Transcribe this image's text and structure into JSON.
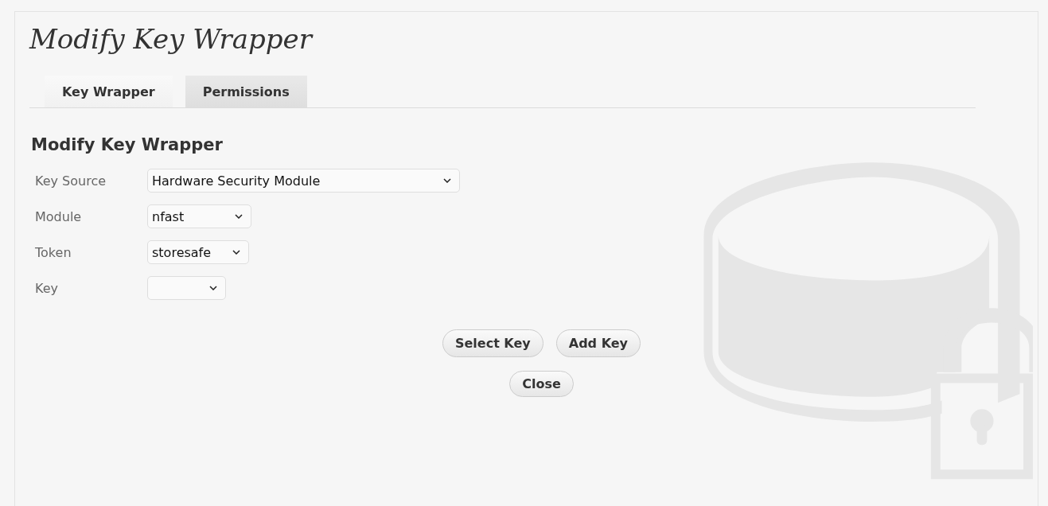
{
  "page_title": "Modify Key Wrapper",
  "tabs": [
    {
      "label": "Key Wrapper",
      "selected": true
    },
    {
      "label": "Permissions",
      "selected": false
    }
  ],
  "section_heading": "Modify Key Wrapper",
  "fields": [
    {
      "label": "Key Source",
      "value": "Hardware Security Module"
    },
    {
      "label": "Module",
      "value": "nfast"
    },
    {
      "label": "Token",
      "value": "storesafe"
    },
    {
      "label": "Key"
    }
  ],
  "buttons": [
    {
      "label": "Select Key",
      "kind": "action"
    },
    {
      "label": "Add Key",
      "kind": "action"
    },
    {
      "label": "Close",
      "kind": "dismiss"
    }
  ]
}
